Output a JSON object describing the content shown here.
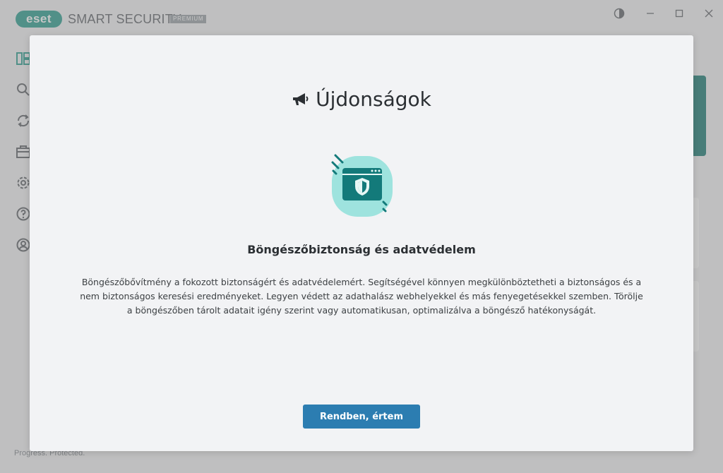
{
  "app": {
    "logo_text": "eset",
    "product_name": "SMART SECURITY",
    "edition_badge": "PREMIUM",
    "status_footer": "Progress. Protected.",
    "sidebar_icons": [
      "dashboard-icon",
      "search-icon",
      "update-icon",
      "tools-icon",
      "settings-icon",
      "help-icon",
      "account-icon"
    ],
    "window_controls": [
      "contrast-icon",
      "minimize-icon",
      "maximize-icon",
      "close-icon"
    ]
  },
  "modal": {
    "icon": "megaphone-icon",
    "title": "Újdonságok",
    "feature": {
      "illustration": "browser-shield-icon",
      "title": "Böngészőbiztonság és adatvédelem",
      "description": "Böngészőbővítmény a fokozott biztonságért és adatvédelemért. Segítségével könnyen megkülönböztetheti a biztonságos és a nem biztonságos keresési eredményeket. Legyen védett az adathalász webhelyekkel és más fenyegetésekkel szemben. Törölje a böngészőben tárolt adatait igény szerint vagy automatikusan, optimalizálva a böngésző hatékonyságát."
    },
    "button_label": "Rendben, értem"
  },
  "colors": {
    "brand": "#2a9d8f",
    "primary_button": "#2c7db1",
    "illustration_bg": "#9ee3de",
    "illustration_fg": "#137a7a"
  }
}
